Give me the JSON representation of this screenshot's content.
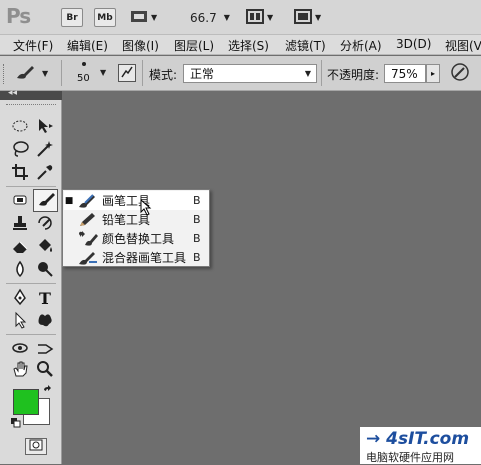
{
  "appbar": {
    "logo": "Ps",
    "bridge_label": "Br",
    "minibridge_label": "Mb",
    "zoom_value": "66.7"
  },
  "menus": [
    "文件(F)",
    "编辑(E)",
    "图像(I)",
    "图层(L)",
    "选择(S)",
    "滤镜(T)",
    "分析(A)",
    "3D(D)",
    "视图(V"
  ],
  "options": {
    "brush_size": "50",
    "mode_label": "模式:",
    "mode_value": "正常",
    "opacity_label": "不透明度:",
    "opacity_value": "75%"
  },
  "flyout": {
    "items": [
      {
        "label": "画笔工具",
        "key": "B",
        "icon": "brush-icon",
        "selected": true
      },
      {
        "label": "铅笔工具",
        "key": "B",
        "icon": "pencil-icon",
        "selected": false
      },
      {
        "label": "颜色替换工具",
        "key": "B",
        "icon": "color-replacement-icon",
        "selected": false
      },
      {
        "label": "混合器画笔工具",
        "key": "B",
        "icon": "mixer-brush-icon",
        "selected": false
      }
    ]
  },
  "colors": {
    "foreground": "#1fc11f",
    "background": "#ffffff",
    "canvas": "#6e6e6e"
  },
  "watermark": {
    "logo": "→ 4sIT.com",
    "caption": "电脑软硬件应用网"
  }
}
